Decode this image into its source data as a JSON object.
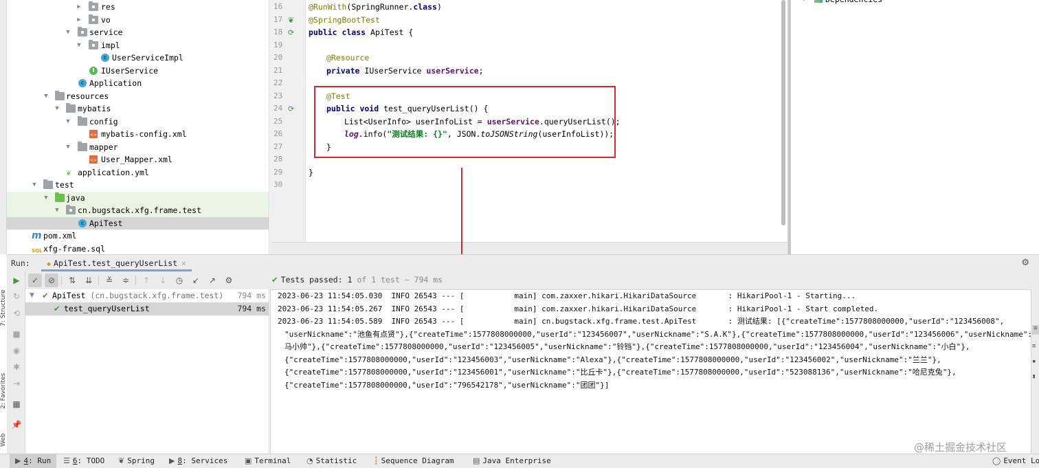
{
  "project_tree": {
    "items": [
      {
        "label": "res",
        "type": "package",
        "expanded": false
      },
      {
        "label": "vo",
        "type": "package",
        "expanded": false
      },
      {
        "label": "service",
        "type": "package",
        "expanded": true
      },
      {
        "label": "impl",
        "type": "package",
        "expanded": true
      },
      {
        "label": "UserServiceImpl",
        "type": "class"
      },
      {
        "label": "IUserService",
        "type": "interface"
      },
      {
        "label": "Application",
        "type": "spring-class"
      },
      {
        "label": "resources",
        "type": "resources-folder",
        "expanded": true
      },
      {
        "label": "mybatis",
        "type": "folder",
        "expanded": true
      },
      {
        "label": "config",
        "type": "folder",
        "expanded": true
      },
      {
        "label": "mybatis-config.xml",
        "type": "xml"
      },
      {
        "label": "mapper",
        "type": "folder",
        "expanded": true
      },
      {
        "label": "User_Mapper.xml",
        "type": "xml"
      },
      {
        "label": "application.yml",
        "type": "yml"
      },
      {
        "label": "test",
        "type": "folder",
        "expanded": true
      },
      {
        "label": "java",
        "type": "source-folder",
        "expanded": true
      },
      {
        "label": "cn.bugstack.xfg.frame.test",
        "type": "package",
        "expanded": true
      },
      {
        "label": "ApiTest",
        "type": "test-class",
        "selected": true
      },
      {
        "label": "pom.xml",
        "type": "maven"
      },
      {
        "label": "xfg-frame.sql",
        "type": "sql"
      }
    ]
  },
  "editor": {
    "line_numbers": [
      "16",
      "17",
      "18",
      "19",
      "20",
      "21",
      "22",
      "23",
      "24",
      "25",
      "26",
      "27",
      "28",
      "29",
      "30"
    ],
    "code": {
      "l16_anno": "@RunWith",
      "l16_rest": "(SpringRunner.",
      "l16_kw": "class",
      "l16_end": ")",
      "l17_anno": "@SpringBootTest",
      "l18_kw": "public class",
      "l18_rest": " ApiTest {",
      "l20_anno": "@Resource",
      "l21_kw": "private",
      "l21_rest": " IUserService ",
      "l21_field": "userService",
      "l21_end": ";",
      "l23_anno": "@Test",
      "l24_kw": "public void",
      "l24_rest": " test_queryUserList() {",
      "l25_start": "List<UserInfo> userInfoList = ",
      "l25_field": "userService",
      "l25_end": ".queryUserList();",
      "l26_log": "log",
      "l26_mid": ".info(",
      "l26_str": "\"测试结果: {}\"",
      "l26_mid2": ", JSON.",
      "l26_ital": "toJSONString",
      "l26_end": "(userInfoList));",
      "l27": "}",
      "l29": "}"
    }
  },
  "right_panel": {
    "item_label": "Dependencies"
  },
  "run_window": {
    "run_label": "Run:",
    "tab_label": "ApiTest.test_queryUserList",
    "tab_close": "×",
    "status": {
      "prefix": "Tests passed:",
      "passed": "1",
      "suffix": "of 1 test – 794 ms"
    },
    "test_tree": [
      {
        "label": "ApiTest",
        "detail": "(cn.bugstack.xfg.frame.test)",
        "time": "794 ms"
      },
      {
        "label": "test_queryUserList",
        "time": "794 ms",
        "selected": true
      }
    ],
    "console_lines": [
      "2023-06-23 11:54:05.030  INFO 26543 --- [           main] com.zaxxer.hikari.HikariDataSource       : HikariPool-1 - Starting...",
      "2023-06-23 11:54:05.267  INFO 26543 --- [           main] com.zaxxer.hikari.HikariDataSource       : HikariPool-1 - Start completed.",
      "2023-06-23 11:54:05.589  INFO 26543 --- [           main] cn.bugstack.xfg.frame.test.ApiTest       : 测试结果: [{\"createTime\":1577808000000,\"userId\":\"123456008\",",
      "\"userNickname\":\"池鱼有点贤\"},{\"createTime\":1577808000000,\"userId\":\"123456007\",\"userNickname\":\"S.A.K\"},{\"createTime\":1577808000000,\"userId\":\"123456006\",\"userNickname\":\"",
      "马小帅\"},{\"createTime\":1577808000000,\"userId\":\"123456005\",\"userNickname\":\"铃铛\"},{\"createTime\":1577808000000,\"userId\":\"123456004\",\"userNickname\":\"小白\"},",
      "{\"createTime\":1577808000000,\"userId\":\"123456003\",\"userNickname\":\"Alexa\"},{\"createTime\":1577808000000,\"userId\":\"123456002\",\"userNickname\":\"兰兰\"},",
      "{\"createTime\":1577808000000,\"userId\":\"123456001\",\"userNickname\":\"比丘卡\"},{\"createTime\":1577808000000,\"userId\":\"523088136\",\"userNickname\":\"哈尼克兔\"},",
      "{\"createTime\":1577808000000,\"userId\":\"796542178\",\"userNickname\":\"团团\"}]"
    ]
  },
  "left_vertical_labels": {
    "structure": "7: Structure",
    "favorites": "2: Favorites",
    "web": "Web"
  },
  "bottom_bar": {
    "items": [
      {
        "num": "4",
        "label": ": Run",
        "active": true
      },
      {
        "num": "6",
        "label": ": TODO"
      },
      {
        "num": "",
        "label": "Spring"
      },
      {
        "num": "8",
        "label": ": Services"
      },
      {
        "num": "",
        "label": "Terminal"
      },
      {
        "num": "",
        "label": "Statistic"
      },
      {
        "num": "",
        "label": "Sequence Diagram"
      },
      {
        "num": "",
        "label": "Java Enterprise"
      }
    ],
    "event_log": "Event Log"
  },
  "watermark": "@稀土掘金技术社区",
  "colors": {
    "highlight_box": "#d9262c",
    "pass_green": "#3f9a3f",
    "selected_row": "#d5d5d5",
    "source_row": "#eaf6e3"
  }
}
